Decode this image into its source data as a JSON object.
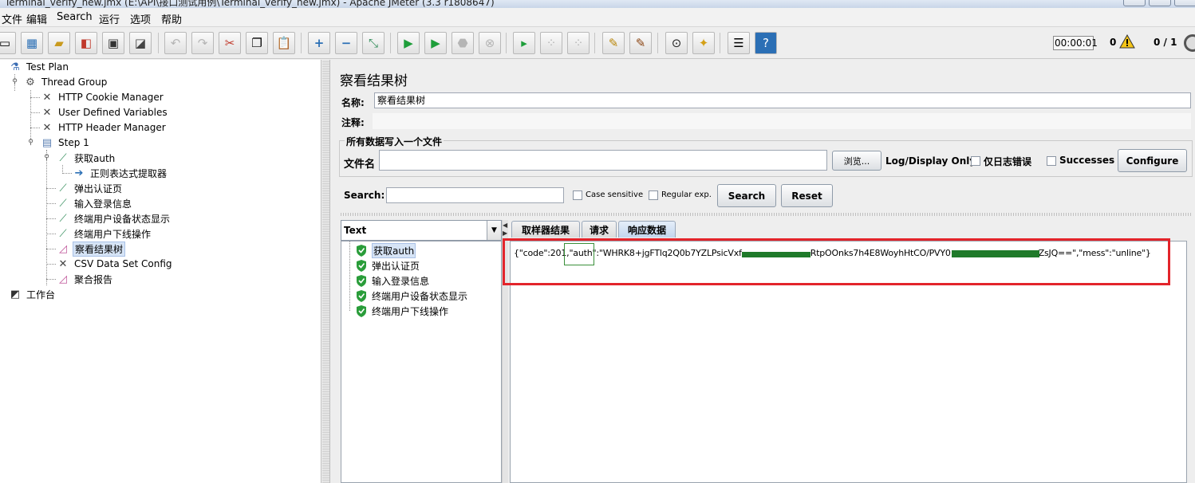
{
  "window": {
    "title": "Terminal_verify_new.jmx (E:\\API\\接口测试用例\\Terminal_verify_new.jmx) - Apache JMeter (3.3 r1808647)"
  },
  "menu": [
    "文件",
    "编辑",
    "Search",
    "运行",
    "选项",
    "帮助"
  ],
  "toolbar": {
    "timer": "00:00:01",
    "error_count": "0",
    "threads": "0 / 1"
  },
  "tree": {
    "test_plan": "Test Plan",
    "thread_group": "Thread Group",
    "cookie_manager": "HTTP Cookie Manager",
    "user_vars": "User Defined Variables",
    "header_manager": "HTTP Header Manager",
    "step1": "Step 1",
    "get_auth": "获取auth",
    "regex_extractor": "正则表达式提取器",
    "popup_auth": "弹出认证页",
    "input_login": "输入登录信息",
    "device_status": "终端用户设备状态显示",
    "offline_op": "终端用户下线操作",
    "view_results": "察看结果树",
    "csv_config": "CSV Data Set Config",
    "aggregate": "聚合报告",
    "workbench": "工作台"
  },
  "panel": {
    "title": "察看结果树",
    "name_label": "名称:",
    "name_value": "察看结果树",
    "comment_label": "注释:",
    "file_section": "所有数据写入一个文件",
    "filename_label": "文件名",
    "browse_label": "浏览...",
    "log_display_label": "Log/Display Only:",
    "errors_only_label": "仅日志错误",
    "successes_label": "Successes",
    "configure_label": "Configure",
    "search_label": "Search:",
    "case_sensitive_label": "Case sensitive",
    "regexp_label": "Regular exp.",
    "search_button": "Search",
    "reset_button": "Reset"
  },
  "results": {
    "renderer": "Text",
    "samples": [
      "获取auth",
      "弹出认证页",
      "输入登录信息",
      "终端用户设备状态显示",
      "终端用户下线操作"
    ],
    "tabs": [
      "取样器结果",
      "请求",
      "响应数据"
    ],
    "response_prefix": "{\"code\":201,\"auth\":\"WHRK8+jgFTlq2Q0b7YZLPsicVxf",
    "response_mid": "RtpOOnks7h4E8WoyhHtCO/PVY0",
    "response_suffix": "ZsJQ==\",\"mess\":\"unline\"}"
  },
  "colors": {
    "selection": "#d6e4f6",
    "annotation_red": "#e3242b",
    "redaction_green": "#1f7a2a",
    "success_green": "#2a9d3a"
  }
}
